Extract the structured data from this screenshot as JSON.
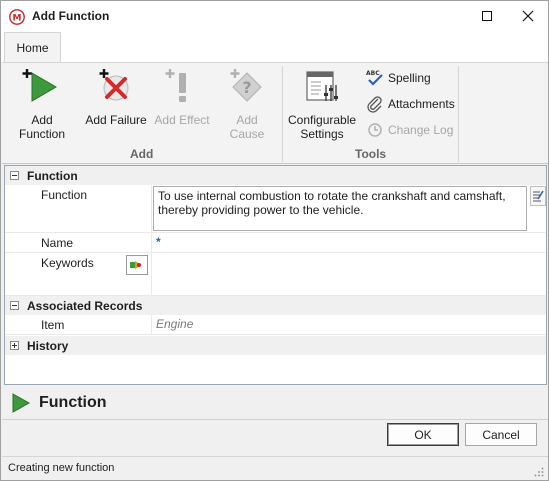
{
  "window": {
    "title": "Add Function"
  },
  "tabs": [
    {
      "label": "Home"
    }
  ],
  "ribbon": {
    "add_group": {
      "label": "Add",
      "buttons": [
        {
          "label": "Add Function",
          "icon": "add-function-icon",
          "enabled": true
        },
        {
          "label": "Add Failure",
          "icon": "add-failure-icon",
          "enabled": true
        },
        {
          "label": "Add Effect",
          "icon": "add-effect-icon",
          "enabled": false
        },
        {
          "label": "Add Cause",
          "icon": "add-cause-icon",
          "enabled": false
        }
      ]
    },
    "tools_group": {
      "label": "Tools",
      "configurable": {
        "label": "Configurable Settings",
        "line1": "Configurable",
        "line2": "Settings"
      },
      "spelling": {
        "label": "Spelling",
        "enabled": true
      },
      "attachments": {
        "label": "Attachments",
        "enabled": true
      },
      "change_log": {
        "label": "Change Log",
        "enabled": false
      }
    }
  },
  "properties": {
    "function_section": {
      "title": "Function",
      "expanded": true
    },
    "function_row": {
      "label": "Function",
      "value": "To use internal combustion to rotate the crankshaft and camshaft, thereby providing power to the vehicle."
    },
    "name_row": {
      "label": "Name",
      "value": "*"
    },
    "keywords_row": {
      "label": "Keywords"
    },
    "associated_section": {
      "title": "Associated Records",
      "expanded": true
    },
    "item_row": {
      "label": "Item",
      "value": "Engine"
    },
    "history_section": {
      "title": "History",
      "expanded": false
    }
  },
  "footer": {
    "title": "Function"
  },
  "buttons": {
    "ok": "OK",
    "cancel": "Cancel"
  },
  "status": {
    "text": "Creating new function"
  },
  "colors": {
    "accent_green": "#3c9a3c",
    "failure_red": "#d42a2a",
    "link_blue": "#2a62b8"
  }
}
